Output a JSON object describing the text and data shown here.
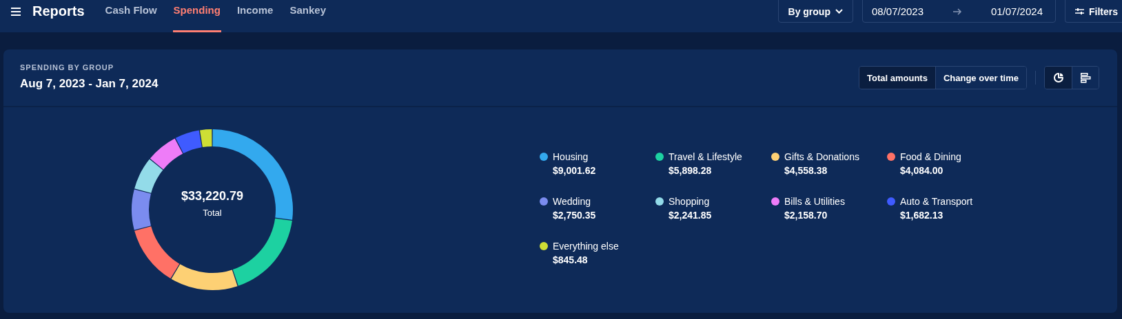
{
  "top_bar": {
    "title": "Reports",
    "tabs": [
      {
        "label": "Cash Flow",
        "selected": false
      },
      {
        "label": "Spending",
        "selected": true
      },
      {
        "label": "Income",
        "selected": false
      },
      {
        "label": "Sankey",
        "selected": false
      }
    ],
    "group_dropdown": "By group",
    "date_range": {
      "start": "08/07/2023",
      "end": "01/07/2024"
    },
    "filters_button": "Filters"
  },
  "report": {
    "eyebrow": "SPENDING BY GROUP",
    "date_range": "Aug 7, 2023 - Jan 7, 2024",
    "modes": [
      {
        "label": "Total amounts",
        "selected": true
      },
      {
        "label": "Change over time",
        "selected": false
      }
    ],
    "views": [
      {
        "kind": "pie",
        "selected": true
      },
      {
        "kind": "bars",
        "selected": false
      }
    ],
    "total": {
      "amount": "$33,220.79",
      "label": "Total"
    },
    "chart_data": {
      "type": "donut",
      "categories": [
        "Housing",
        "Travel & Lifestyle",
        "Gifts & Donations",
        "Food & Dining",
        "Wedding",
        "Shopping",
        "Bills & Utilities",
        "Auto & Transport",
        "Everything else"
      ],
      "values": [
        27.1,
        17.75,
        13.72,
        12.29,
        8.28,
        6.75,
        6.5,
        5.06,
        2.55
      ]
    },
    "legend": [
      {
        "amount": "$9,001.62",
        "color": "#33a9ee"
      },
      {
        "amount": "$5,898.28",
        "color": "#1dd1a1"
      },
      {
        "amount": "$4,558.38",
        "color": "#fdd074"
      },
      {
        "amount": "$4,084.00",
        "color": "#ff7166"
      },
      {
        "amount": "$2,750.35",
        "color": "#7b8cef"
      },
      {
        "amount": "$2,241.85",
        "color": "#93dbe9"
      },
      {
        "amount": "$2,158.70",
        "color": "#ee7cf8"
      },
      {
        "amount": "$1,682.13",
        "color": "#3f5bff"
      },
      {
        "amount": "$845.48",
        "color": "#cede35"
      }
    ]
  }
}
